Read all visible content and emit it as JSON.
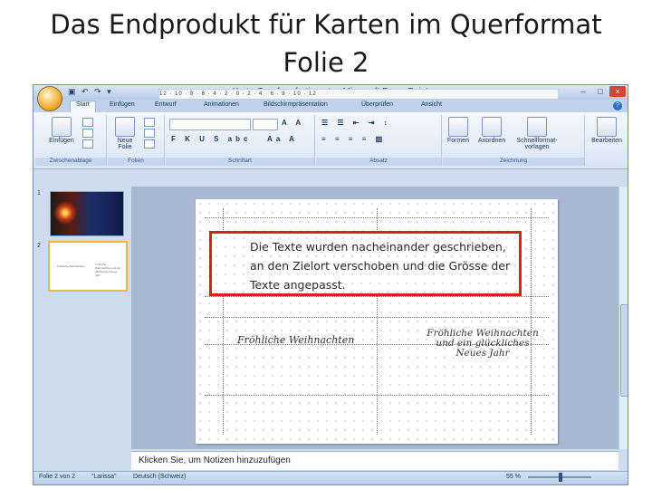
{
  "slide": {
    "title_line1": "Das Endprodukt für Karten im Querformat",
    "title_line2": "Folie 2"
  },
  "window": {
    "title": "Karte.Querformfertig.pptx - Microsoft PowerPoint",
    "minimize": "–",
    "maximize": "□",
    "close": "×"
  },
  "ribbon": {
    "tabs": [
      "Start",
      "Einfügen",
      "Entwurf",
      "Animationen",
      "Bildschirmpräsentation",
      "Überprüfen",
      "Ansicht"
    ],
    "groups": {
      "clipboard": "Zwischenablage",
      "slides": "Folien",
      "font": "Schriftart",
      "paragraph": "Absatz",
      "drawing": "Zeichnung"
    },
    "buttons": {
      "paste": "Einfügen",
      "new_slide": "Neue Folie",
      "shapes": "Formen",
      "arrange": "Anordnen",
      "quick_styles": "Schnellformat-vorlagen",
      "edit": "Bearbeiten"
    }
  },
  "ruler_top": "12 · 10 · 8 · 6 · 4 · 2 · 0 · 2 · 4 · 6 · 8 · 10 · 12",
  "thumbnails": [
    {
      "number": "1"
    },
    {
      "number": "2",
      "text_left": "Fröhliche Weihnachten",
      "text_right": "Fröhliche Weihnachten und ein glückliches Neues Jahr"
    }
  ],
  "slide_content": {
    "greeting_left": "Fröhliche Weihnachten",
    "greeting_right_line1": "Fröhliche Weihnachten",
    "greeting_right_line2": "und ein glückliches",
    "greeting_right_line3": "Neues Jahr"
  },
  "notes_placeholder": "Klicken Sie, um Notizen hinzuzufügen",
  "statusbar": {
    "slide_info": "Folie 2 von 2",
    "theme": "\"Larissa\"",
    "language": "Deutsch (Schweiz)",
    "zoom": "55 %"
  },
  "callout": {
    "text": "Die Texte wurden nacheinander geschrieben, an den Zielort verschoben und die Grösse der Texte angepasst."
  },
  "colors": {
    "callout_border": "#d91f1f",
    "ribbon_accent": "#cfdced"
  }
}
